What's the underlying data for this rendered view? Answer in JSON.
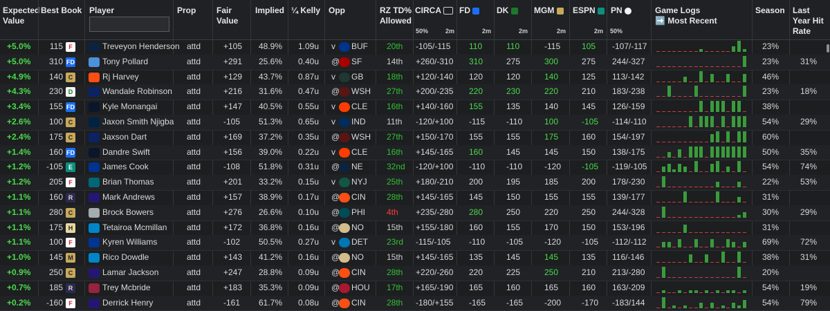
{
  "headers": {
    "ev": "Expected Value",
    "best_book": "Best Book",
    "player": "Player",
    "prop": "Prop",
    "fair_value": "Fair Value",
    "implied": "Implied",
    "kelly": "¼ Kelly",
    "opp": "Opp",
    "rz": "RZ TD% Allowed",
    "circa": "CIRCA",
    "fd": "FD",
    "dk": "DK",
    "mgm": "MGM",
    "espn": "ESPN",
    "pn": "PN",
    "game_logs": "Game Logs",
    "most_recent": "➡️ Most Recent",
    "season": "Season",
    "last_year": "Last Year Hit Rate",
    "sub_50": "50%",
    "sub_2m": "2m",
    "pn_50": "50%"
  },
  "search": {
    "placeholder": ""
  },
  "rows": [
    {
      "ev": "+5.0%",
      "book_odds": "115",
      "book": "fanatics",
      "player": "Treveyon Henderson",
      "team": "NE",
      "prop": "attd",
      "fair": "+105",
      "implied": "48.9%",
      "kelly": "1.09u",
      "ha": "v",
      "opp": "BUF",
      "rz": "20th",
      "rz_color": "rz-g",
      "circa": "-105/-115",
      "fd": "110",
      "fd_c": "g",
      "dk": "110",
      "dk_c": "g",
      "mgm": "-115",
      "mgm_c": "w",
      "espn": "105",
      "espn_c": "g",
      "pn": "-107/-117",
      "season": "23%",
      "last": "",
      "log": [
        0,
        0,
        0,
        0,
        0,
        0,
        0,
        0,
        1,
        0,
        0,
        0,
        0,
        0,
        2,
        4,
        1
      ]
    },
    {
      "ev": "+5.0%",
      "book_odds": "310",
      "book": "fanduel",
      "player": "Tony Pollard",
      "team": "TEN",
      "prop": "attd",
      "fair": "+291",
      "implied": "25.6%",
      "kelly": "0.40u",
      "ha": "@",
      "opp": "SF",
      "rz": "14th",
      "rz_color": "rz-w",
      "circa": "+260/-310",
      "fd": "310",
      "fd_c": "g",
      "dk": "275",
      "dk_c": "w",
      "mgm": "300",
      "mgm_c": "g",
      "espn": "275",
      "espn_c": "w",
      "pn": "244/-327",
      "season": "23%",
      "last": "31%",
      "log": [
        0,
        0,
        0,
        0,
        0,
        0,
        0,
        0,
        0,
        0,
        0,
        0,
        0,
        0,
        0,
        0,
        4
      ]
    },
    {
      "ev": "+4.9%",
      "book_odds": "140",
      "book": "caesars",
      "player": "Rj Harvey",
      "team": "DEN",
      "prop": "attd",
      "fair": "+129",
      "implied": "43.7%",
      "kelly": "0.87u",
      "ha": "v",
      "opp": "GB",
      "rz": "18th",
      "rz_color": "rz-g",
      "circa": "+120/-140",
      "fd": "120",
      "fd_c": "w",
      "dk": "120",
      "dk_c": "w",
      "mgm": "140",
      "mgm_c": "g",
      "espn": "125",
      "espn_c": "w",
      "pn": "113/-142",
      "season": "46%",
      "last": "",
      "log": [
        0,
        0,
        0,
        0,
        0,
        2,
        0,
        0,
        4,
        0,
        3,
        0,
        0,
        3,
        0,
        0,
        3
      ]
    },
    {
      "ev": "+4.3%",
      "book_odds": "230",
      "book": "draftkings",
      "player": "Wandale Robinson",
      "team": "NYG",
      "prop": "attd",
      "fair": "+216",
      "implied": "31.6%",
      "kelly": "0.47u",
      "ha": "@",
      "opp": "WSH",
      "rz": "27th",
      "rz_color": "rz-g",
      "circa": "+200/-235",
      "fd": "220",
      "fd_c": "g",
      "dk": "230",
      "dk_c": "g",
      "mgm": "220",
      "mgm_c": "g",
      "espn": "210",
      "espn_c": "w",
      "pn": "183/-238",
      "season": "23%",
      "last": "18%",
      "log": [
        0,
        0,
        4,
        0,
        0,
        0,
        0,
        4,
        0,
        0,
        0,
        0,
        0,
        0,
        0,
        0,
        4
      ]
    },
    {
      "ev": "+3.4%",
      "book_odds": "155",
      "book": "fanduel",
      "player": "Kyle Monangai",
      "team": "CHI",
      "prop": "attd",
      "fair": "+147",
      "implied": "40.5%",
      "kelly": "0.55u",
      "ha": "v",
      "opp": "CLE",
      "rz": "16th",
      "rz_color": "rz-g",
      "circa": "+140/-160",
      "fd": "155",
      "fd_c": "g",
      "dk": "135",
      "dk_c": "w",
      "mgm": "140",
      "mgm_c": "w",
      "espn": "145",
      "espn_c": "w",
      "pn": "126/-159",
      "season": "38%",
      "last": "",
      "log": [
        0,
        0,
        0,
        0,
        0,
        0,
        0,
        0,
        4,
        0,
        4,
        4,
        4,
        0,
        4,
        4,
        0
      ]
    },
    {
      "ev": "+2.6%",
      "book_odds": "100",
      "book": "caesars",
      "player": "Jaxon Smith Njigba",
      "team": "SEA",
      "prop": "attd",
      "fair": "-105",
      "implied": "51.3%",
      "kelly": "0.65u",
      "ha": "v",
      "opp": "IND",
      "rz": "11th",
      "rz_color": "rz-w",
      "circa": "-120/+100",
      "fd": "-115",
      "fd_c": "w",
      "dk": "-110",
      "dk_c": "w",
      "mgm": "100",
      "mgm_c": "g",
      "espn": "-105",
      "espn_c": "g",
      "pn": "-114/-110",
      "season": "54%",
      "last": "29%",
      "log": [
        0,
        0,
        0,
        0,
        0,
        0,
        4,
        0,
        4,
        4,
        4,
        0,
        4,
        0,
        4,
        4,
        4
      ]
    },
    {
      "ev": "+2.4%",
      "book_odds": "175",
      "book": "caesars",
      "player": "Jaxson Dart",
      "team": "NYG",
      "prop": "attd",
      "fair": "+169",
      "implied": "37.2%",
      "kelly": "0.35u",
      "ha": "@",
      "opp": "WSH",
      "rz": "27th",
      "rz_color": "rz-g",
      "circa": "+150/-170",
      "fd": "155",
      "fd_c": "w",
      "dk": "155",
      "dk_c": "w",
      "mgm": "175",
      "mgm_c": "g",
      "espn": "160",
      "espn_c": "w",
      "pn": "154/-197",
      "season": "60%",
      "last": "",
      "log": [
        0,
        0,
        0,
        0,
        0,
        0,
        0,
        0,
        0,
        0,
        3,
        4,
        0,
        4,
        0,
        4,
        4
      ]
    },
    {
      "ev": "+1.4%",
      "book_odds": "160",
      "book": "fanduel",
      "player": "Dandre Swift",
      "team": "CHI",
      "prop": "attd",
      "fair": "+156",
      "implied": "39.0%",
      "kelly": "0.22u",
      "ha": "v",
      "opp": "CLE",
      "rz": "16th",
      "rz_color": "rz-g",
      "circa": "+145/-165",
      "fd": "160",
      "fd_c": "g",
      "dk": "145",
      "dk_c": "w",
      "mgm": "145",
      "mgm_c": "w",
      "espn": "150",
      "espn_c": "w",
      "pn": "138/-175",
      "season": "50%",
      "last": "35%",
      "log": [
        0,
        0,
        2,
        0,
        3,
        0,
        4,
        4,
        4,
        0,
        4,
        4,
        4,
        4,
        4,
        4,
        4
      ]
    },
    {
      "ev": "+1.2%",
      "book_odds": "-105",
      "book": "espn",
      "player": "James Cook",
      "team": "BUF",
      "prop": "attd",
      "fair": "-108",
      "implied": "51.8%",
      "kelly": "0.31u",
      "ha": "@",
      "opp": "NE",
      "rz": "32nd",
      "rz_color": "rz-g",
      "circa": "-120/+100",
      "fd": "-110",
      "fd_c": "w",
      "dk": "-110",
      "dk_c": "w",
      "mgm": "-120",
      "mgm_c": "w",
      "espn": "-105",
      "espn_c": "g",
      "pn": "-119/-105",
      "season": "54%",
      "last": "74%",
      "log": [
        0,
        2,
        3,
        1,
        3,
        2,
        0,
        4,
        0,
        0,
        3,
        4,
        0,
        2,
        0,
        4,
        0
      ]
    },
    {
      "ev": "+1.2%",
      "book_odds": "205",
      "book": "fanatics",
      "player": "Brian Thomas",
      "team": "JAX",
      "prop": "attd",
      "fair": "+201",
      "implied": "33.2%",
      "kelly": "0.15u",
      "ha": "v",
      "opp": "NYJ",
      "rz": "25th",
      "rz_color": "rz-g",
      "circa": "+180/-210",
      "fd": "200",
      "fd_c": "w",
      "dk": "195",
      "dk_c": "w",
      "mgm": "185",
      "mgm_c": "w",
      "espn": "200",
      "espn_c": "w",
      "pn": "178/-230",
      "season": "22%",
      "last": "53%",
      "log": [
        0,
        4,
        0,
        0,
        0,
        0,
        0,
        0,
        0,
        0,
        0,
        2,
        0,
        0,
        0,
        2,
        0
      ]
    },
    {
      "ev": "+1.1%",
      "book_odds": "160",
      "book": "betrivers",
      "player": "Mark Andrews",
      "team": "BAL",
      "prop": "attd",
      "fair": "+157",
      "implied": "38.9%",
      "kelly": "0.17u",
      "ha": "@",
      "opp": "CIN",
      "rz": "28th",
      "rz_color": "rz-g",
      "circa": "+145/-165",
      "fd": "145",
      "fd_c": "w",
      "dk": "150",
      "dk_c": "w",
      "mgm": "155",
      "mgm_c": "w",
      "espn": "155",
      "espn_c": "w",
      "pn": "139/-177",
      "season": "31%",
      "last": "",
      "log": [
        0,
        0,
        0,
        0,
        0,
        4,
        0,
        0,
        0,
        0,
        0,
        4,
        0,
        0,
        0,
        2,
        0
      ]
    },
    {
      "ev": "+1.1%",
      "book_odds": "280",
      "book": "caesars",
      "player": "Brock Bowers",
      "team": "LV",
      "prop": "attd",
      "fair": "+276",
      "implied": "26.6%",
      "kelly": "0.10u",
      "ha": "@",
      "opp": "PHI",
      "rz": "4th",
      "rz_color": "r",
      "circa": "+235/-280",
      "fd": "280",
      "fd_c": "g",
      "dk": "250",
      "dk_c": "w",
      "mgm": "220",
      "mgm_c": "w",
      "espn": "250",
      "espn_c": "w",
      "pn": "244/-328",
      "season": "30%",
      "last": "29%",
      "log": [
        0,
        4,
        0,
        0,
        0,
        0,
        0,
        0,
        0,
        0,
        0,
        0,
        0,
        0,
        0,
        1,
        2
      ]
    },
    {
      "ev": "+1.1%",
      "book_odds": "175",
      "book": "hardrock",
      "player": "Tetairoa Mcmillan",
      "team": "CAR",
      "prop": "attd",
      "fair": "+172",
      "implied": "36.8%",
      "kelly": "0.16u",
      "ha": "@",
      "opp": "NO",
      "rz": "15th",
      "rz_color": "rz-w",
      "circa": "+155/-180",
      "fd": "160",
      "fd_c": "w",
      "dk": "155",
      "dk_c": "w",
      "mgm": "170",
      "mgm_c": "w",
      "espn": "150",
      "espn_c": "w",
      "pn": "153/-196",
      "season": "31%",
      "last": "",
      "log": [
        0,
        0,
        0,
        0,
        0,
        3,
        0,
        0,
        0,
        0,
        0,
        0,
        0,
        0,
        0,
        0,
        0
      ]
    },
    {
      "ev": "+1.1%",
      "book_odds": "100",
      "book": "fanatics",
      "player": "Kyren Williams",
      "team": "LAR",
      "prop": "attd",
      "fair": "-102",
      "implied": "50.5%",
      "kelly": "0.27u",
      "ha": "v",
      "opp": "DET",
      "rz": "23rd",
      "rz_color": "rz-g",
      "circa": "-115/-105",
      "fd": "-110",
      "fd_c": "w",
      "dk": "-105",
      "dk_c": "w",
      "mgm": "-120",
      "mgm_c": "w",
      "espn": "-105",
      "espn_c": "w",
      "pn": "-112/-112",
      "season": "69%",
      "last": "72%",
      "log": [
        0,
        2,
        2,
        0,
        3,
        0,
        0,
        3,
        0,
        0,
        3,
        0,
        0,
        3,
        2,
        0,
        2
      ]
    },
    {
      "ev": "+1.0%",
      "book_odds": "145",
      "book": "betmgm",
      "player": "Rico Dowdle",
      "team": "CAR",
      "prop": "attd",
      "fair": "+143",
      "implied": "41.2%",
      "kelly": "0.16u",
      "ha": "@",
      "opp": "NO",
      "rz": "15th",
      "rz_color": "rz-w",
      "circa": "+145/-165",
      "fd": "135",
      "fd_c": "w",
      "dk": "145",
      "dk_c": "w",
      "mgm": "145",
      "mgm_c": "g",
      "espn": "135",
      "espn_c": "w",
      "pn": "116/-146",
      "season": "38%",
      "last": "31%",
      "log": [
        0,
        0,
        0,
        0,
        0,
        0,
        3,
        0,
        0,
        3,
        0,
        0,
        4,
        0,
        0,
        4,
        0
      ]
    },
    {
      "ev": "+0.9%",
      "book_odds": "250",
      "book": "caesars",
      "player": "Lamar Jackson",
      "team": "BAL",
      "prop": "attd",
      "fair": "+247",
      "implied": "28.8%",
      "kelly": "0.09u",
      "ha": "@",
      "opp": "CIN",
      "rz": "28th",
      "rz_color": "rz-g",
      "circa": "+220/-260",
      "fd": "220",
      "fd_c": "w",
      "dk": "225",
      "dk_c": "w",
      "mgm": "250",
      "mgm_c": "g",
      "espn": "210",
      "espn_c": "w",
      "pn": "213/-280",
      "season": "20%",
      "last": "",
      "log": [
        0,
        4,
        0,
        0,
        0,
        0,
        0,
        0,
        0,
        0,
        0,
        0,
        0,
        0,
        0,
        4,
        0
      ]
    },
    {
      "ev": "+0.7%",
      "book_odds": "185",
      "book": "betrivers",
      "player": "Trey Mcbride",
      "team": "ARI",
      "prop": "attd",
      "fair": "+183",
      "implied": "35.3%",
      "kelly": "0.09u",
      "ha": "@",
      "opp": "HOU",
      "rz": "17th",
      "rz_color": "rz-g",
      "circa": "+165/-190",
      "fd": "165",
      "fd_c": "w",
      "dk": "160",
      "dk_c": "w",
      "mgm": "165",
      "mgm_c": "w",
      "espn": "160",
      "espn_c": "w",
      "pn": "163/-209",
      "season": "54%",
      "last": "19%",
      "log": [
        0,
        1,
        0,
        0,
        1,
        0,
        1,
        1,
        0,
        1,
        0,
        1,
        0,
        1,
        1,
        0,
        1
      ]
    },
    {
      "ev": "+0.2%",
      "book_odds": "-160",
      "book": "fanatics",
      "player": "Derrick Henry",
      "team": "BAL",
      "prop": "attd",
      "fair": "-161",
      "implied": "61.7%",
      "kelly": "0.08u",
      "ha": "@",
      "opp": "CIN",
      "rz": "28th",
      "rz_color": "rz-g",
      "circa": "-180/+155",
      "fd": "-165",
      "fd_c": "w",
      "dk": "-165",
      "dk_c": "w",
      "mgm": "-200",
      "mgm_c": "w",
      "espn": "-170",
      "espn_c": "w",
      "pn": "-183/144",
      "season": "54%",
      "last": "79%",
      "log": [
        0,
        4,
        0,
        1,
        0,
        1,
        0,
        0,
        2,
        0,
        2,
        0,
        1,
        0,
        2,
        1,
        3
      ]
    }
  ],
  "colors": {
    "green": "#4cd94c",
    "red": "#ff3b3b",
    "bar": "#3b9a3b",
    "bg": "#1c1e20"
  }
}
